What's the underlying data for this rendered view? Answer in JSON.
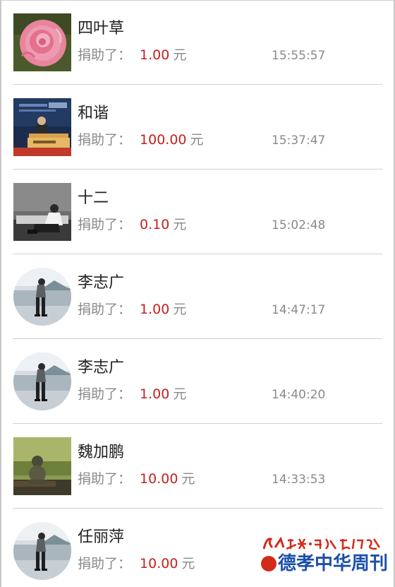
{
  "donations": [
    {
      "name": "四叶草",
      "label": "捐助了：",
      "amount": "1.00",
      "unit": "元",
      "time": "15:55:57",
      "avatar": "rose-photo"
    },
    {
      "name": "和谐",
      "label": "捐助了：",
      "amount": "100.00",
      "unit": "元",
      "time": "15:37:47",
      "avatar": "speaker-photo"
    },
    {
      "name": "十二",
      "label": "捐助了：",
      "amount": "0.10",
      "unit": "元",
      "time": "15:02:48",
      "avatar": "sitting-person-photo"
    },
    {
      "name": "李志广",
      "label": "捐助了：",
      "amount": "1.00",
      "unit": "元",
      "time": "14:47:17",
      "avatar": "lakeside-person-photo"
    },
    {
      "name": "李志广",
      "label": "捐助了：",
      "amount": "1.00",
      "unit": "元",
      "time": "14:40:20",
      "avatar": "lakeside-person-photo"
    },
    {
      "name": "魏加鹏",
      "label": "捐助了：",
      "amount": "10.00",
      "unit": "元",
      "time": "14:33:53",
      "avatar": "buddha-figurine-photo"
    },
    {
      "name": "任丽萍",
      "label": "捐助了：",
      "amount": "10.00",
      "unit": "元",
      "time": "",
      "avatar": "lakeside-person-photo"
    }
  ],
  "watermark": {
    "top_line": "人民日报·市场报网络版",
    "title": "德孝中华周刊"
  },
  "colors": {
    "amount": "#c62020",
    "muted_text": "#8a8a8a",
    "name_text": "#222222",
    "divider": "#cfcfcf",
    "watermark_blue": "#1c4fa8",
    "watermark_red": "#d42a1a"
  }
}
